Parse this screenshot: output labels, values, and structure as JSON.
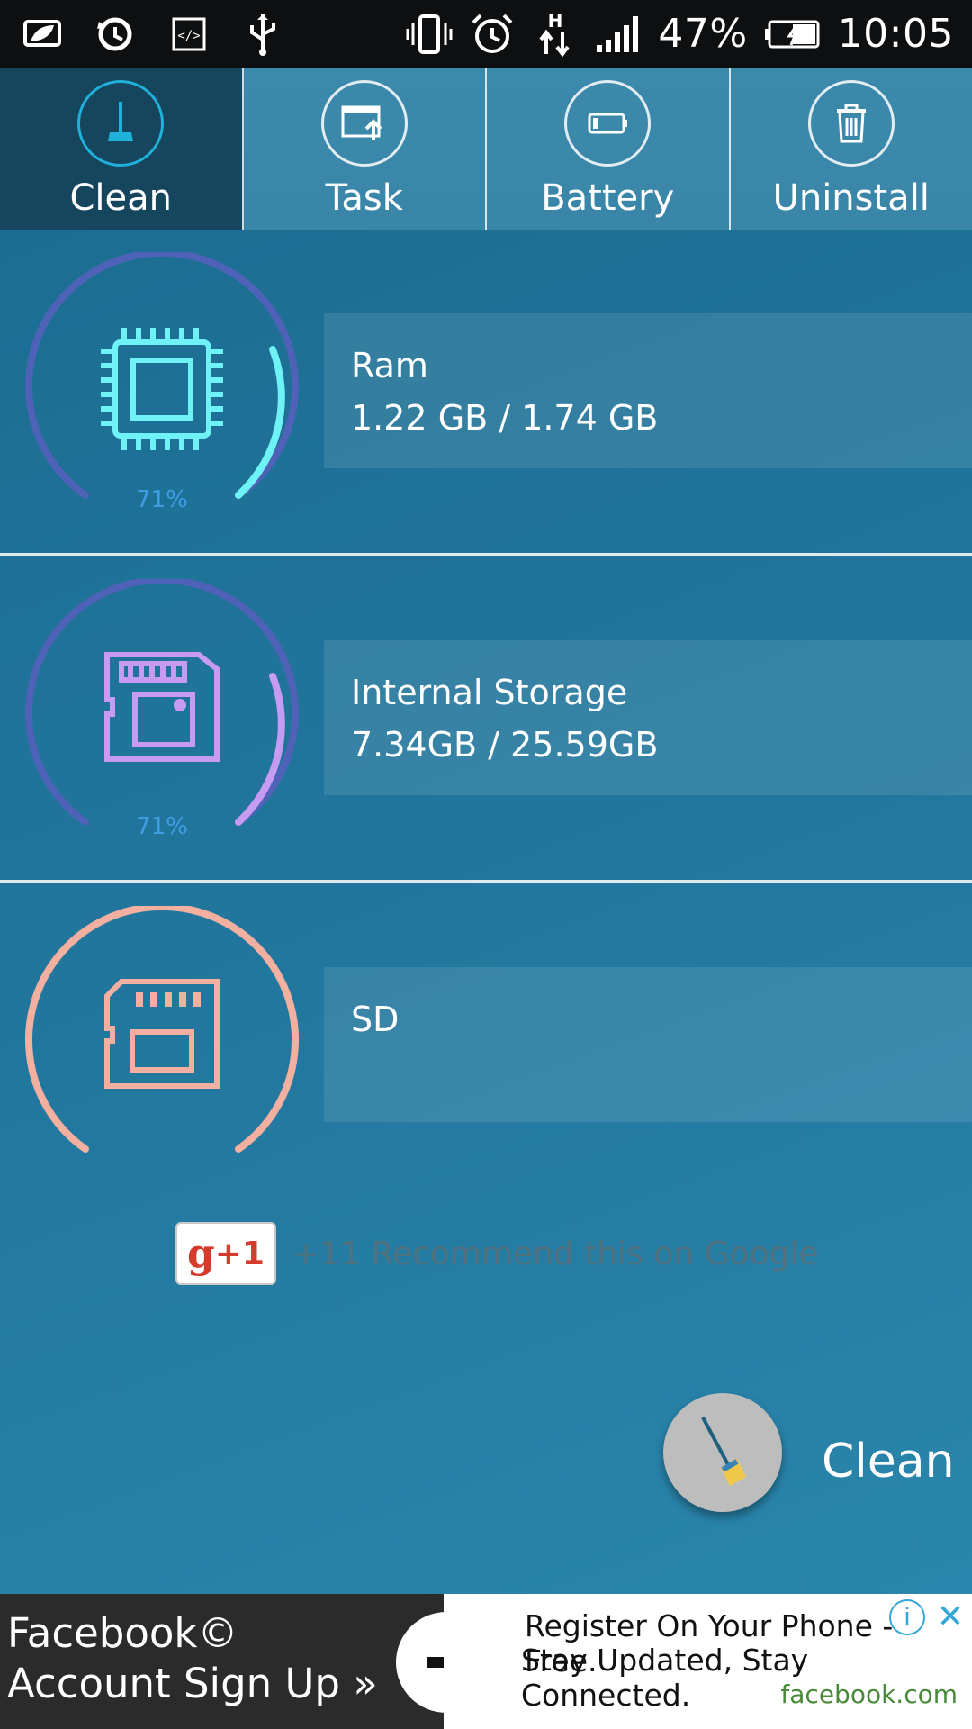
{
  "status_bar": {
    "battery_percent": "47%",
    "time": "10:05",
    "left_icons": [
      "leaf-icon",
      "sync-icon",
      "code-icon",
      "usb-icon"
    ],
    "right_icons": [
      "vibrate-icon",
      "alarm-icon",
      "network-h-icon",
      "signal-icon",
      "battery-icon"
    ]
  },
  "tabs": [
    {
      "label": "Clean",
      "icon": "broom-icon",
      "active": true
    },
    {
      "label": "Task",
      "icon": "window-upload-icon",
      "active": false
    },
    {
      "label": "Battery",
      "icon": "battery-icon",
      "active": false
    },
    {
      "label": "Uninstall",
      "icon": "trash-icon",
      "active": false
    }
  ],
  "storage": [
    {
      "title": "Ram",
      "value": "1.22 GB / 1.74 GB",
      "percent_label": "71%",
      "arc_fill": 0.71,
      "icon": "chip-icon",
      "color": "#6ef2f6"
    },
    {
      "title": "Internal Storage",
      "value": "7.34GB / 25.59GB",
      "percent_label": "71%",
      "arc_fill": 0.71,
      "icon": "memory-card-icon",
      "color": "#c79bf2"
    },
    {
      "title": "SD",
      "value": "",
      "percent_label": "",
      "arc_fill": 1.0,
      "icon": "sd-card-icon",
      "color": "#f3b0a0"
    }
  ],
  "gplus": {
    "button_g": "g",
    "button_plus": "+1",
    "text": "+11 Recommend this on Google"
  },
  "clean_action": {
    "label": "Clean"
  },
  "ad": {
    "left_line1": "Facebook©",
    "left_line2": "Account Sign Up »",
    "right_line1": "Register On Your Phone - Free.",
    "right_line2": "Stay Updated, Stay Connected.",
    "right_line3": "facebook.com"
  },
  "colors": {
    "background": "#1a6a8e",
    "tab_active": "#16465e",
    "arc_track": "#4e63b8",
    "ram_arc": "#6ef2f6",
    "storage_arc": "#c79bf2",
    "sd_arc": "#f3b0a0",
    "percent_text": "#3f9de3"
  }
}
